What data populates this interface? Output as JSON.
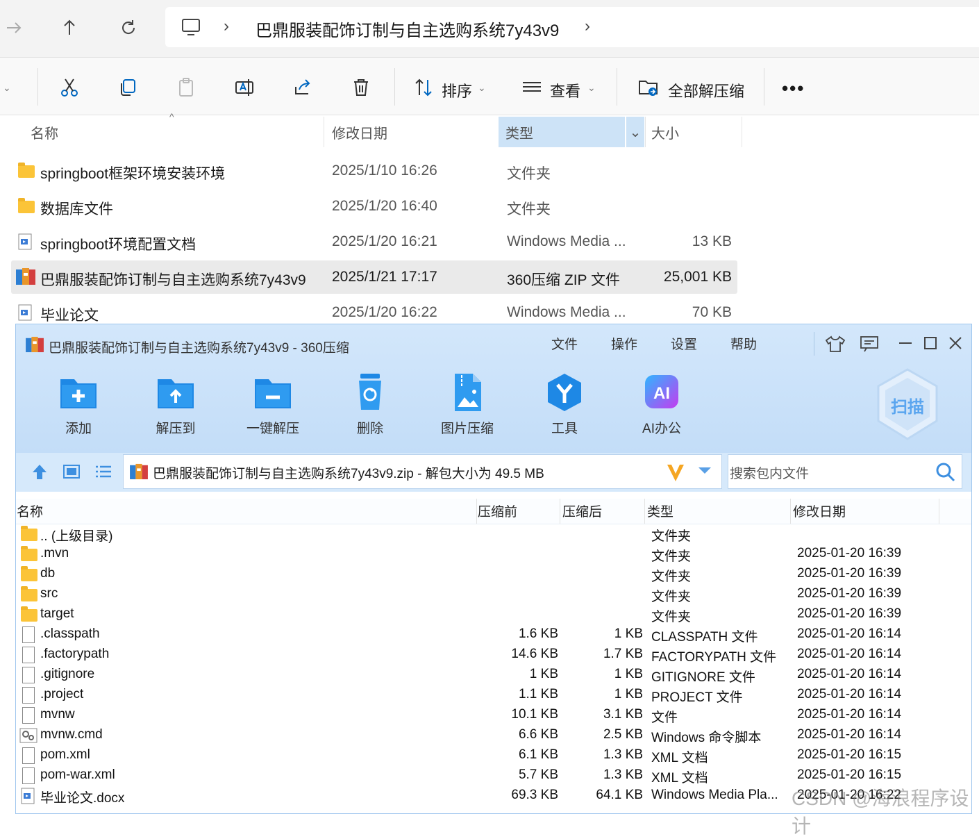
{
  "explorer": {
    "address": {
      "path": "巴鼎服装配饰订制与自主选购系统7y43v9"
    },
    "toolbar": {
      "sort_label": "排序",
      "view_label": "查看",
      "extract_all_label": "全部解压缩"
    },
    "columns": {
      "name": "名称",
      "date": "修改日期",
      "type": "类型",
      "size": "大小"
    },
    "rows": [
      {
        "name": "springboot框架环境安装环境",
        "date": "2025/1/10 16:26",
        "type": "文件夹",
        "size": "",
        "icon": "folder-icon"
      },
      {
        "name": "数据库文件",
        "date": "2025/1/20 16:40",
        "type": "文件夹",
        "size": "",
        "icon": "folder-icon"
      },
      {
        "name": "springboot环境配置文档",
        "date": "2025/1/20 16:21",
        "type": "Windows Media ...",
        "size": "13 KB",
        "icon": "media-file-icon"
      },
      {
        "name": "巴鼎服装配饰订制与自主选购系统7y43v9",
        "date": "2025/1/21 17:17",
        "type": "360压缩 ZIP 文件",
        "size": "25,001 KB",
        "icon": "zip-archive-icon"
      },
      {
        "name": "毕业论文",
        "date": "2025/1/20 16:22",
        "type": "Windows Media ...",
        "size": "70 KB",
        "icon": "media-file-icon"
      }
    ]
  },
  "zipwin": {
    "title": "巴鼎服装配饰订制与自主选购系统7y43v9 - 360压缩",
    "menu": [
      "文件",
      "操作",
      "设置",
      "帮助"
    ],
    "tools": [
      {
        "label": "添加",
        "icon": "add-folder-icon"
      },
      {
        "label": "解压到",
        "icon": "extract-to-icon"
      },
      {
        "label": "一键解压",
        "icon": "one-click-extract-icon"
      },
      {
        "label": "删除",
        "icon": "delete-bin-icon"
      },
      {
        "label": "图片压缩",
        "icon": "image-compress-icon"
      },
      {
        "label": "工具",
        "icon": "tools-icon"
      },
      {
        "label": "AI办公",
        "icon": "ai-office-icon"
      }
    ],
    "scan_label": "扫描",
    "path_text": "巴鼎服装配饰订制与自主选购系统7y43v9.zip - 解包大小为 49.5 MB",
    "search_placeholder": "搜索包内文件",
    "columns": {
      "name": "名称",
      "before": "压缩前",
      "after": "压缩后",
      "type": "类型",
      "date": "修改日期"
    },
    "rows": [
      {
        "name": ".. (上级目录)",
        "before": "",
        "after": "",
        "type": "文件夹",
        "date": "",
        "icon": "folder"
      },
      {
        "name": ".mvn",
        "before": "",
        "after": "",
        "type": "文件夹",
        "date": "2025-01-20 16:39",
        "icon": "folder"
      },
      {
        "name": "db",
        "before": "",
        "after": "",
        "type": "文件夹",
        "date": "2025-01-20 16:39",
        "icon": "folder"
      },
      {
        "name": "src",
        "before": "",
        "after": "",
        "type": "文件夹",
        "date": "2025-01-20 16:39",
        "icon": "folder"
      },
      {
        "name": "target",
        "before": "",
        "after": "",
        "type": "文件夹",
        "date": "2025-01-20 16:39",
        "icon": "folder"
      },
      {
        "name": ".classpath",
        "before": "1.6 KB",
        "after": "1 KB",
        "type": "CLASSPATH 文件",
        "date": "2025-01-20 16:14",
        "icon": "file"
      },
      {
        "name": ".factorypath",
        "before": "14.6 KB",
        "after": "1.7 KB",
        "type": "FACTORYPATH 文件",
        "date": "2025-01-20 16:14",
        "icon": "file"
      },
      {
        "name": ".gitignore",
        "before": "1 KB",
        "after": "1 KB",
        "type": "GITIGNORE 文件",
        "date": "2025-01-20 16:14",
        "icon": "file"
      },
      {
        "name": ".project",
        "before": "1.1 KB",
        "after": "1 KB",
        "type": "PROJECT 文件",
        "date": "2025-01-20 16:14",
        "icon": "file"
      },
      {
        "name": "mvnw",
        "before": "10.1 KB",
        "after": "3.1 KB",
        "type": "文件",
        "date": "2025-01-20 16:14",
        "icon": "file"
      },
      {
        "name": "mvnw.cmd",
        "before": "6.6 KB",
        "after": "2.5 KB",
        "type": "Windows 命令脚本",
        "date": "2025-01-20 16:14",
        "icon": "script"
      },
      {
        "name": "pom.xml",
        "before": "6.1 KB",
        "after": "1.3 KB",
        "type": "XML 文档",
        "date": "2025-01-20 16:15",
        "icon": "file"
      },
      {
        "name": "pom-war.xml",
        "before": "5.7 KB",
        "after": "1.3 KB",
        "type": "XML 文档",
        "date": "2025-01-20 16:15",
        "icon": "file"
      },
      {
        "name": "毕业论文.docx",
        "before": "69.3 KB",
        "after": "64.1 KB",
        "type": "Windows Media Pla...",
        "date": "2025-01-20 16:22",
        "icon": "media"
      }
    ]
  },
  "watermark": "CSDN @海浪程序设计"
}
